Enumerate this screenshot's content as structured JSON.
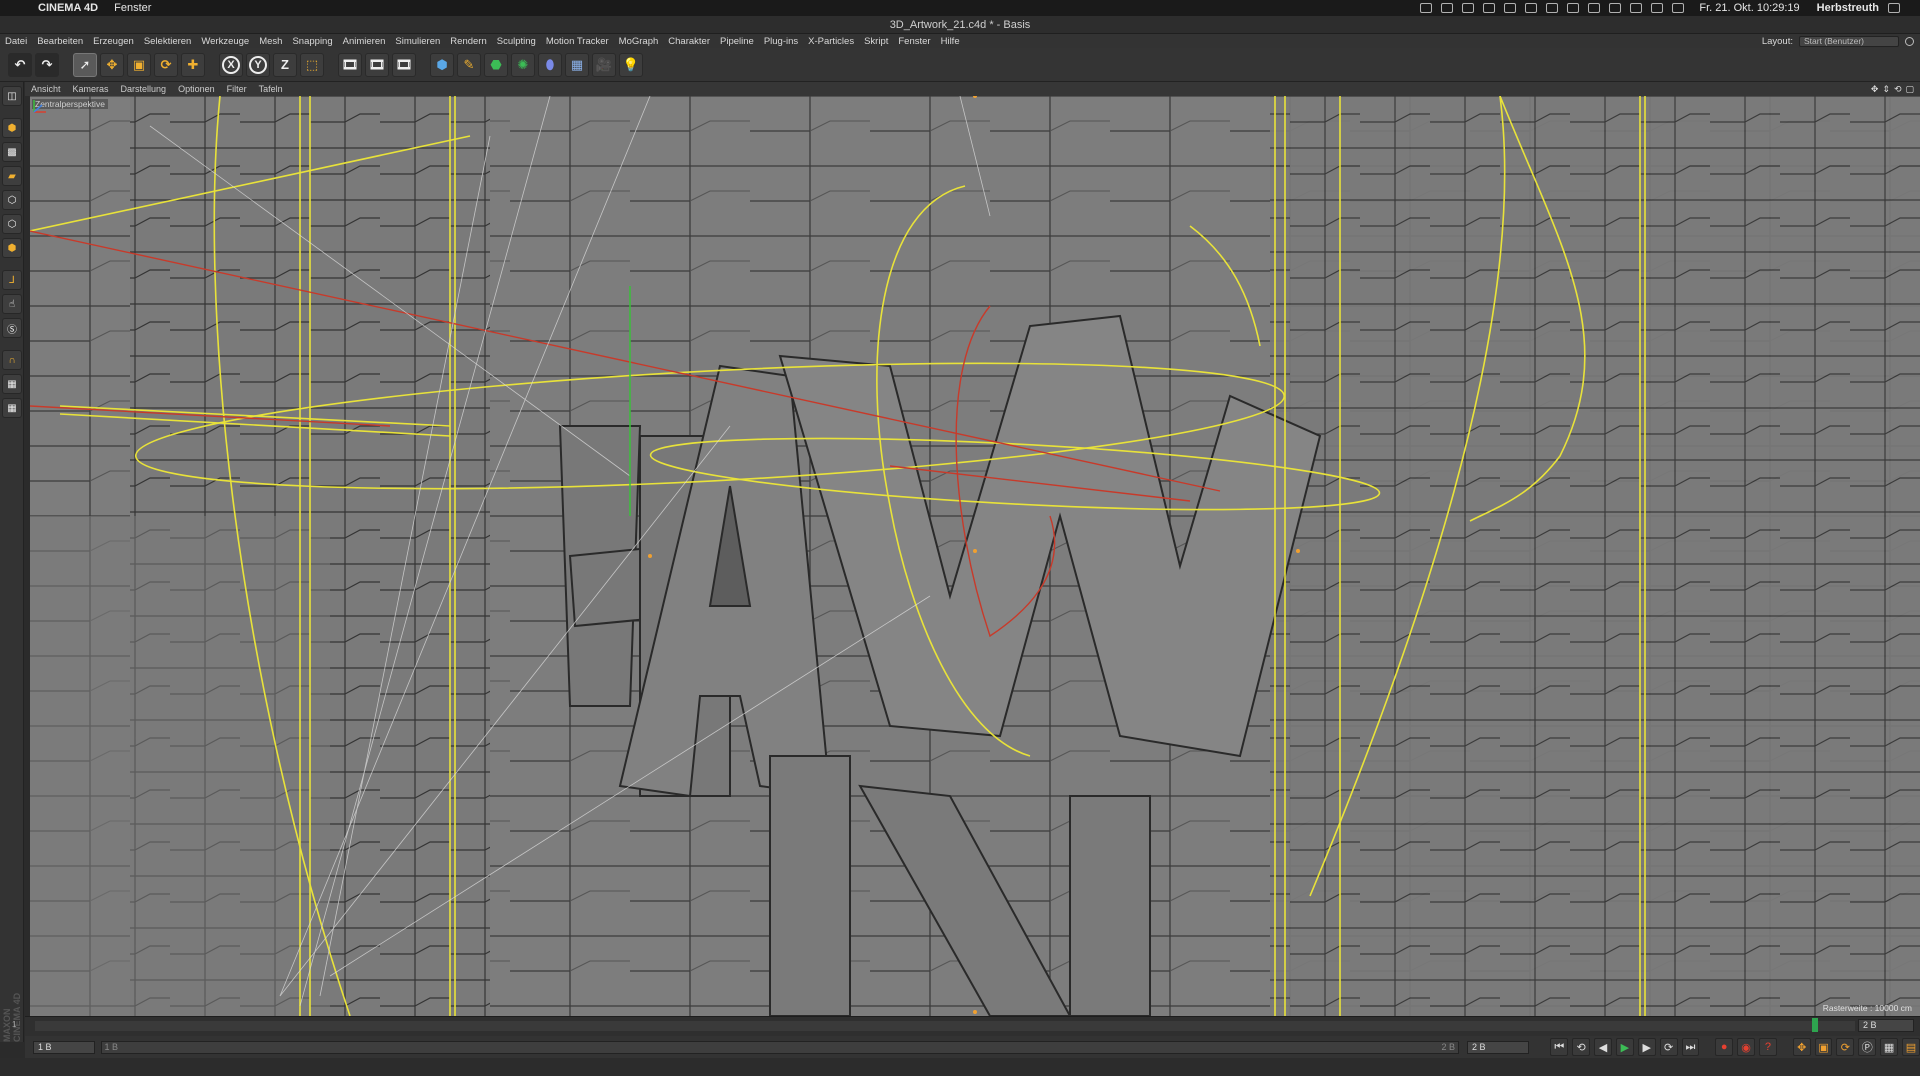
{
  "mac": {
    "app_name": "CINEMA 4D",
    "menu": [
      "Fenster"
    ],
    "clock": "Fr. 21. Okt.  10:29:19",
    "user": "Herbstreuth"
  },
  "window_title": "3D_Artwork_21.c4d * - Basis",
  "app_menu": [
    "Datei",
    "Bearbeiten",
    "Erzeugen",
    "Selektieren",
    "Werkzeuge",
    "Mesh",
    "Snapping",
    "Animieren",
    "Simulieren",
    "Rendern",
    "Sculpting",
    "Motion Tracker",
    "MoGraph",
    "Charakter",
    "Pipeline",
    "Plug-ins",
    "X-Particles",
    "Skript",
    "Fenster",
    "Hilfe"
  ],
  "layout": {
    "label": "Layout:",
    "value": "Start (Benutzer)"
  },
  "toolbar": {
    "axis_x": "X",
    "axis_y": "Y",
    "axis_z": "Z",
    "icons": [
      "undo-icon",
      "redo-icon",
      "select-icon",
      "move-icon",
      "scale-icon",
      "rotate-icon",
      "add-icon",
      "x-axis-lock",
      "y-axis-lock",
      "z-axis-lock",
      "coordinate-system-icon",
      "render-view-icon",
      "render-picture-viewer-icon",
      "render-settings-icon",
      "cube-icon",
      "pen-spline-icon",
      "subdivision-icon",
      "array-icon",
      "deformer-icon",
      "floor-icon",
      "camera-icon",
      "light-icon"
    ]
  },
  "viewport_menu": [
    "Ansicht",
    "Kameras",
    "Darstellung",
    "Optionen",
    "Filter",
    "Tafeln"
  ],
  "viewport": {
    "label": "Zentralperspektive",
    "grid_info": "Rasterweite : 10000 cm"
  },
  "timeline": {
    "start_tick": "1",
    "end_frame": "2 B"
  },
  "transport": {
    "current_frame": "1 B",
    "min_field": "2 B",
    "slider_left": "1 B",
    "slider_right": "2 B"
  },
  "brand": "MAXON CINEMA 4D",
  "colors": {
    "viewport_bg": "#7c7c7c",
    "spline_yellow": "#e8e23a",
    "spline_red": "#c83a2a",
    "axis_green": "#3bbf3b"
  }
}
